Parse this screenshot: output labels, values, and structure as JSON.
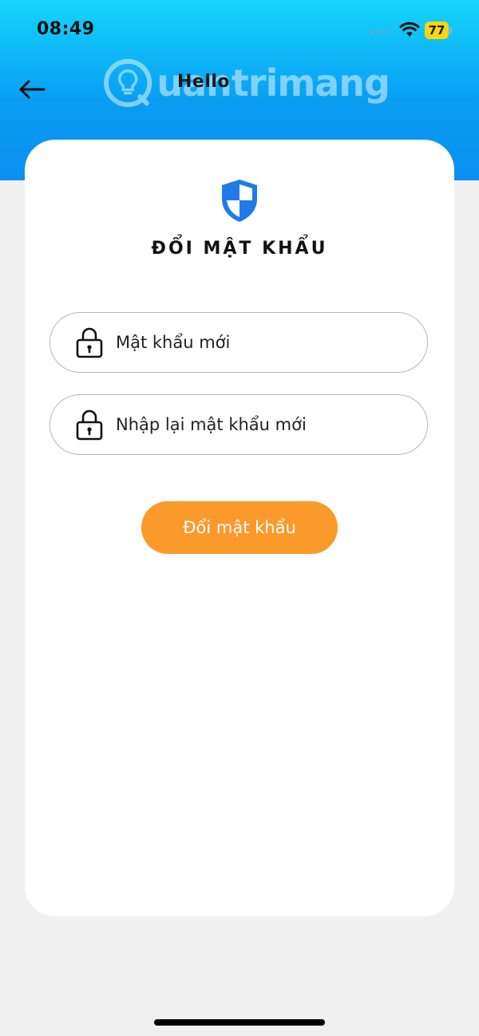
{
  "status_bar": {
    "time": "08:49",
    "battery_level": "77",
    "wifi_icon": "wifi-icon",
    "battery_color": "#ffd60a"
  },
  "header": {
    "title": "Hello",
    "back_icon": "arrow-left-icon",
    "gradient_top": "#14d6fb",
    "gradient_bottom": "#0a8ff0"
  },
  "watermark": {
    "text": "uantrimang",
    "icon": "lightbulb-icon"
  },
  "card": {
    "icon": "shield-icon",
    "title": "ĐỔI MẬT KHẨU",
    "fields": [
      {
        "placeholder": "Mật khẩu mới",
        "icon": "lock-icon",
        "value": ""
      },
      {
        "placeholder": "Nhập lại mật khẩu mới",
        "icon": "lock-icon",
        "value": ""
      }
    ],
    "submit_label": "Đổi mật khẩu",
    "submit_color": "#fb9a2a",
    "accent_color": "#1f7ae8"
  }
}
